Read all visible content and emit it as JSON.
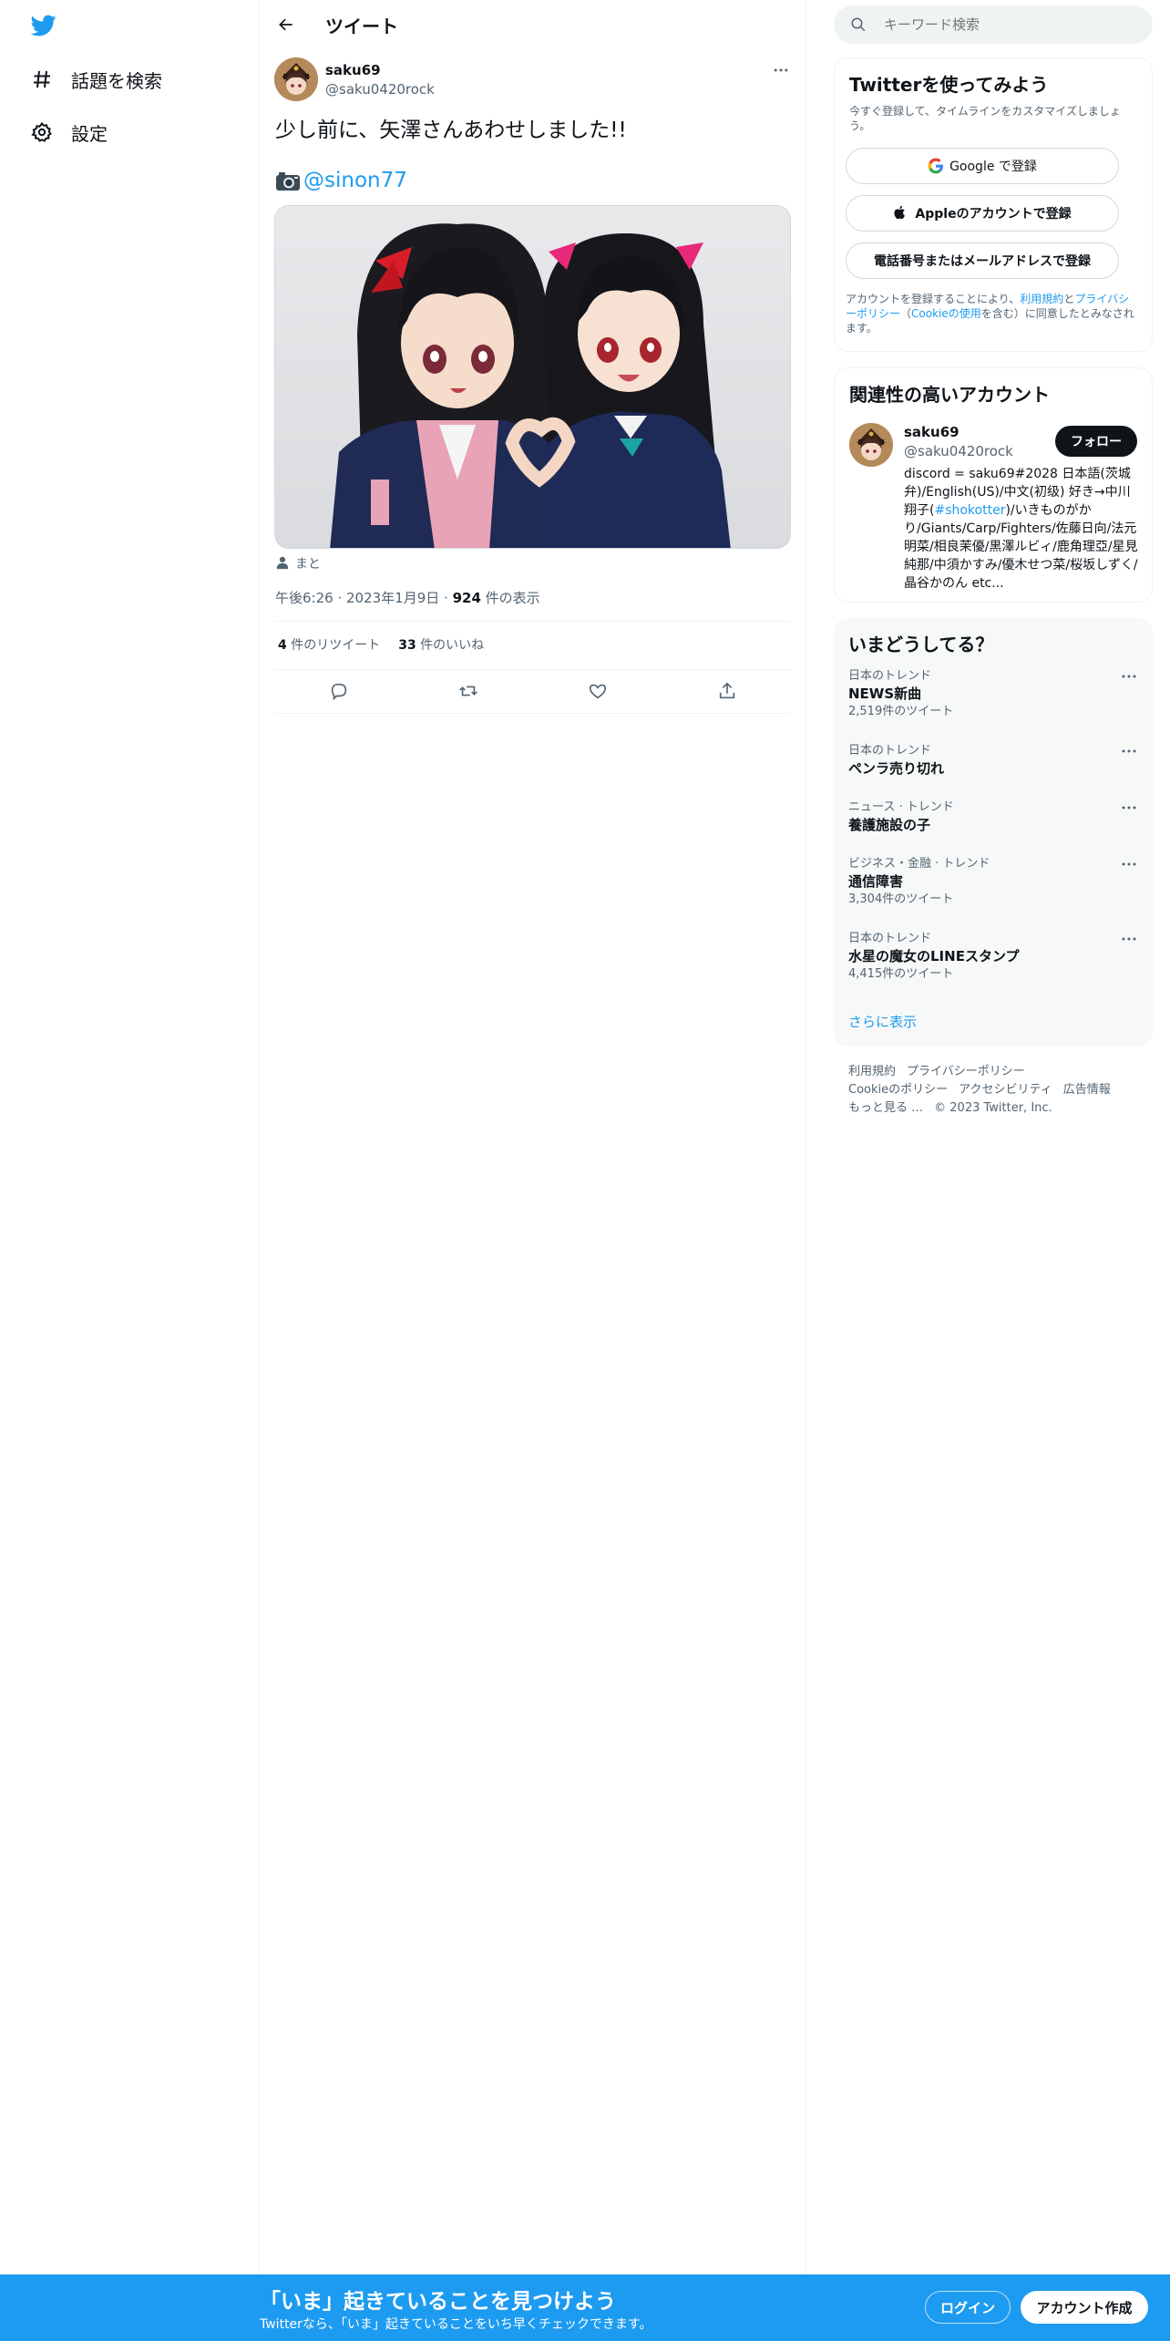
{
  "nav": {
    "logo": "twitter-bird-icon",
    "items": [
      {
        "label": "話題を検索",
        "icon": "hashtag-icon"
      },
      {
        "label": "設定",
        "icon": "gear-icon"
      }
    ]
  },
  "header": {
    "title": "ツイート",
    "back_icon": "arrow-left-icon"
  },
  "tweet": {
    "author_name": "saku69",
    "author_handle": "@saku0420rock",
    "text": "少し前に、矢澤さんあわせしました!!",
    "credit_icon": "camera-icon",
    "credit_mention": "@sinon77",
    "tagged_user": "まと",
    "time": "午後6:26",
    "date": "2023年1月9日",
    "views_count": "924",
    "views_label": " 件の表示",
    "retweets_count": "4",
    "retweets_label": " 件のリツイート",
    "likes_count": "33",
    "likes_label": " 件のいいね"
  },
  "search": {
    "placeholder": "キーワード検索"
  },
  "signup_card": {
    "title": "Twitterを使ってみよう",
    "subtitle": "今すぐ登録して、タイムラインをカスタマイズしましょう。",
    "google_label": "Google で登録",
    "apple_label": "Appleのアカウントで登録",
    "phone_label": "電話番号またはメールアドレスで登録",
    "terms_prefix": "アカウントを登録することにより、",
    "terms_link": "利用規約",
    "terms_and": "と",
    "privacy_link": "プライバシーポリシー",
    "terms_paren_open": "（",
    "cookie_link": "Cookieの使用",
    "terms_suffix": "を含む）に同意したとみなされます。"
  },
  "related": {
    "title": "関連性の高いアカウント",
    "name": "saku69",
    "handle": "@saku0420rock",
    "follow_label": "フォロー",
    "bio_before": "discord = saku69#2028 日本語(茨城弁)/English(US)/中文(初级) 好き→中川翔子(",
    "bio_tag": "#shokotter",
    "bio_after": ")/いきものがかり/Giants/Carp/Fighters/佐藤日向/法元明菜/相良茉優/黒澤ルビィ/鹿角理亞/星見純那/中須かすみ/優木せつ菜/桜坂しずく/晶谷かのん etc..."
  },
  "trends": {
    "title": "いまどうしてる？",
    "items": [
      {
        "context": "日本のトレンド",
        "name": "NEWS新曲",
        "count": "2,519件のツイート"
      },
      {
        "context": "日本のトレンド",
        "name": "ペンラ売り切れ",
        "count": ""
      },
      {
        "context": "ニュース · トレンド",
        "name": "養護施設の子",
        "count": ""
      },
      {
        "context": "ビジネス・金融 · トレンド",
        "name": "通信障害",
        "count": "3,304件のツイート"
      },
      {
        "context": "日本のトレンド",
        "name": "水星の魔女のLINEスタンプ",
        "count": "4,415件のツイート"
      }
    ],
    "show_more": "さらに表示"
  },
  "footer": {
    "links": [
      "利用規約",
      "プライバシーポリシー",
      "Cookieのポリシー",
      "アクセシビリティ",
      "広告情報",
      "もっと見る …"
    ],
    "copyright": "© 2023 Twitter, Inc."
  },
  "bottom_bar": {
    "title": "「いま」起きていることを見つけよう",
    "subtitle": "Twitterなら、「いま」起きていることをいち早くチェックできます。",
    "login_label": "ログイン",
    "signup_label": "アカウント作成"
  },
  "colors": {
    "accent": "#1d9bf0",
    "text": "#0f1419",
    "muted": "#536471"
  }
}
